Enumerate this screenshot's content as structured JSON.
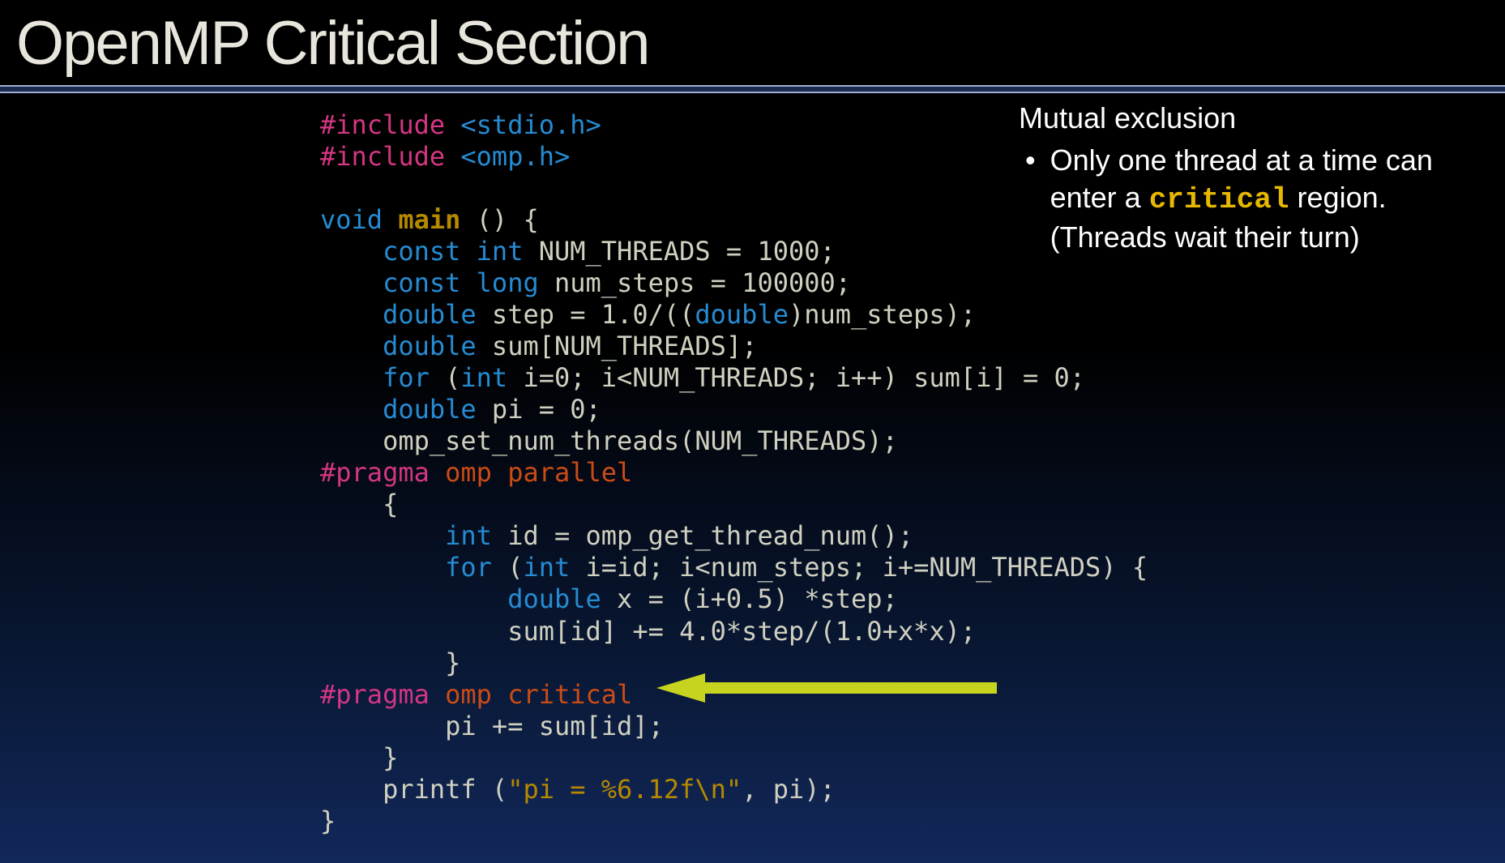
{
  "title": "OpenMP Critical Section",
  "code": {
    "l1a": "#include",
    "l1b": " <stdio.h>",
    "l2a": "#include",
    "l2b": " <omp.h>",
    "l4a": "void",
    "l4b": " main",
    "l4c": " () {",
    "l5a": "    const int",
    "l5b": " NUM_THREADS = 1000;",
    "l6a": "    const long",
    "l6b": " num_steps = 100000;",
    "l7a": "    double",
    "l7b": " step = 1.0/((",
    "l7c": "double",
    "l7d": ")num_steps);",
    "l8a": "    double",
    "l8b": " sum[NUM_THREADS];",
    "l9a": "    for",
    "l9b": " (",
    "l9c": "int",
    "l9d": " i=0; i<NUM_THREADS; i++) sum[i] = 0;",
    "l10a": "    double",
    "l10b": " pi = 0;",
    "l11": "    omp_set_num_threads(NUM_THREADS);",
    "l12a": "#pragma",
    "l12b": " omp parallel",
    "l13": "    {",
    "l14a": "        int",
    "l14b": " id = omp_get_thread_num();",
    "l15a": "        for",
    "l15b": " (",
    "l15c": "int",
    "l15d": " i=id; i<num_steps; i+=NUM_THREADS) {",
    "l16a": "            double",
    "l16b": " x = (i+0.5) *step;",
    "l17": "            sum[id] += 4.0*step/(1.0+x*x);",
    "l18": "        }",
    "l19a": "#pragma",
    "l19b": " omp critical",
    "l20": "        pi += sum[id];",
    "l21": "    }",
    "l22a": "    printf (",
    "l22b": "\"pi = %6.12f\\n\"",
    "l22c": ", pi);",
    "l23": "}"
  },
  "sidebar": {
    "heading": "Mutual exclusion",
    "bullet_pre": "Only one thread at a time can enter a ",
    "bullet_mono": "critical",
    "bullet_post": " region. (Threads wait their turn)"
  },
  "colors": {
    "arrow": "#c6d420"
  }
}
